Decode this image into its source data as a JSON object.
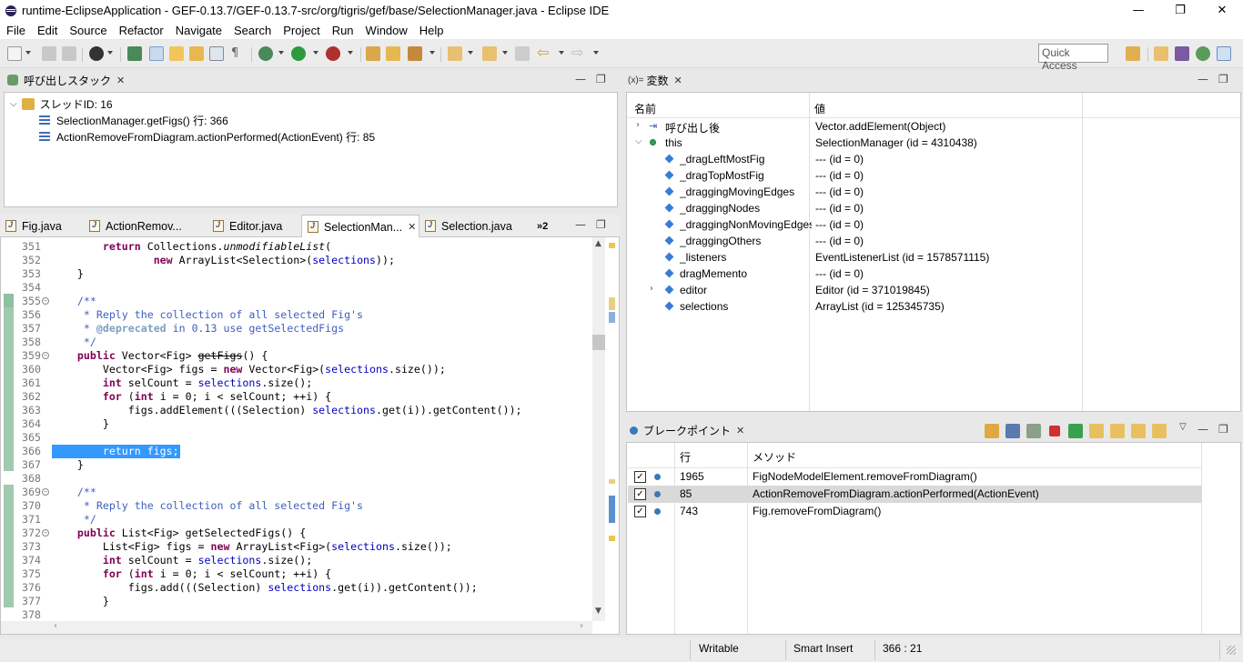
{
  "window": {
    "title": "runtime-EclipseApplication - GEF-0.13.7/GEF-0.13.7-src/org/tigris/gef/base/SelectionManager.java - Eclipse IDE",
    "minimize": "—",
    "maximize": "❐",
    "close": "✕"
  },
  "menu": [
    "File",
    "Edit",
    "Source",
    "Refactor",
    "Navigate",
    "Search",
    "Project",
    "Run",
    "Window",
    "Help"
  ],
  "toolbar": {
    "quick_access": "Quick Access"
  },
  "callstack": {
    "title": "呼び出しスタック",
    "thread": "スレッドID: 16",
    "frames": [
      "SelectionManager.getFigs() 行: 366",
      "ActionRemoveFromDiagram.actionPerformed(ActionEvent) 行: 85"
    ]
  },
  "editor": {
    "tabs": [
      "Fig.java",
      "ActionRemov...",
      "Editor.java",
      "SelectionMan...",
      "Selection.java"
    ],
    "overflow": "»2",
    "lines": [
      {
        "n": "351",
        "t": "        return Collections.unmodifiableList("
      },
      {
        "n": "352",
        "t": "                new ArrayList<Selection>(selections));"
      },
      {
        "n": "353",
        "t": "    }"
      },
      {
        "n": "354",
        "t": ""
      },
      {
        "n": "355",
        "t": "    /**"
      },
      {
        "n": "356",
        "t": "     * Reply the collection of all selected Fig's"
      },
      {
        "n": "357",
        "t": "     * @deprecated in 0.13 use getSelectedFigs"
      },
      {
        "n": "358",
        "t": "     */"
      },
      {
        "n": "359",
        "t": "    public Vector<Fig> getFigs() {"
      },
      {
        "n": "360",
        "t": "        Vector<Fig> figs = new Vector<Fig>(selections.size());"
      },
      {
        "n": "361",
        "t": "        int selCount = selections.size();"
      },
      {
        "n": "362",
        "t": "        for (int i = 0; i < selCount; ++i) {"
      },
      {
        "n": "363",
        "t": "            figs.addElement(((Selection) selections.get(i)).getContent());"
      },
      {
        "n": "364",
        "t": "        }"
      },
      {
        "n": "365",
        "t": ""
      },
      {
        "n": "366",
        "t": "        return figs;"
      },
      {
        "n": "367",
        "t": "    }"
      },
      {
        "n": "368",
        "t": ""
      },
      {
        "n": "369",
        "t": "    /**"
      },
      {
        "n": "370",
        "t": "     * Reply the collection of all selected Fig's"
      },
      {
        "n": "371",
        "t": "     */"
      },
      {
        "n": "372",
        "t": "    public List<Fig> getSelectedFigs() {"
      },
      {
        "n": "373",
        "t": "        List<Fig> figs = new ArrayList<Fig>(selections.size());"
      },
      {
        "n": "374",
        "t": "        int selCount = selections.size();"
      },
      {
        "n": "375",
        "t": "        for (int i = 0; i < selCount; ++i) {"
      },
      {
        "n": "376",
        "t": "            figs.add(((Selection) selections.get(i)).getContent());"
      },
      {
        "n": "377",
        "t": "        }"
      },
      {
        "n": "378",
        "t": ""
      }
    ]
  },
  "variables": {
    "title": "変数",
    "col_name": "名前",
    "col_value": "値",
    "rows": [
      {
        "name": "呼び出し後",
        "value": "Vector.addElement(Object)"
      },
      {
        "name": "this",
        "value": "SelectionManager (id = 4310438)"
      },
      {
        "name": "_dragLeftMostFig",
        "value": "--- (id = 0)"
      },
      {
        "name": "_dragTopMostFig",
        "value": "--- (id = 0)"
      },
      {
        "name": "_draggingMovingEdges",
        "value": "--- (id = 0)"
      },
      {
        "name": "_draggingNodes",
        "value": "--- (id = 0)"
      },
      {
        "name": "_draggingNonMovingEdges",
        "value": "--- (id = 0)"
      },
      {
        "name": "_draggingOthers",
        "value": "--- (id = 0)"
      },
      {
        "name": "_listeners",
        "value": "EventListenerList (id = 1578571115)"
      },
      {
        "name": "dragMemento",
        "value": "--- (id = 0)"
      },
      {
        "name": "editor",
        "value": "Editor (id = 371019845)"
      },
      {
        "name": "selections",
        "value": "ArrayList (id = 125345735)"
      }
    ]
  },
  "breakpoints": {
    "title": "ブレークポイント",
    "col_line": "行",
    "col_method": "メソッド",
    "rows": [
      {
        "line": "1965",
        "method": "FigNodeModelElement.removeFromDiagram()",
        "checked": true
      },
      {
        "line": "85",
        "method": "ActionRemoveFromDiagram.actionPerformed(ActionEvent)",
        "checked": true
      },
      {
        "line": "743",
        "method": "Fig.removeFromDiagram()",
        "checked": true
      }
    ]
  },
  "status": {
    "mode": "Writable",
    "insert": "Smart Insert",
    "position": "366 : 21"
  },
  "colors": {
    "accent": "#0078d7",
    "keyword": "#7f0055",
    "comment": "#3f5fbf",
    "field": "#0000c0"
  }
}
